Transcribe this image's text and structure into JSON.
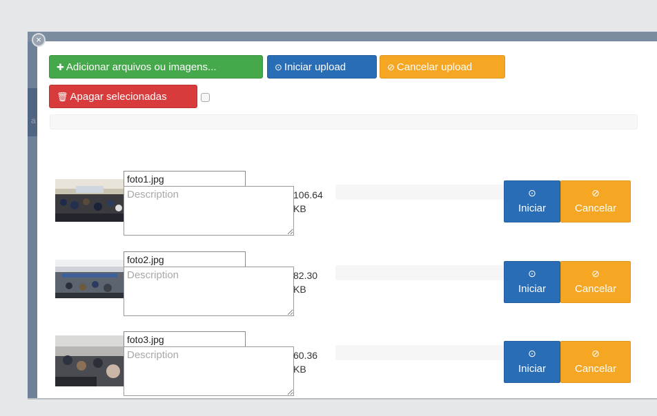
{
  "toolbar": {
    "add_label": "Adicionar arquivos ou imagens...",
    "add_icon": "plus-icon",
    "start_label": "Iniciar upload",
    "start_icon": "circle-arrow-up-icon",
    "cancel_label": "Cancelar upload",
    "cancel_icon": "ban-circle-icon",
    "delete_label": "Apagar selecionadas",
    "delete_icon": "trash-icon"
  },
  "backdrop": {
    "letter": "a"
  },
  "files": [
    {
      "name": "foto1.jpg",
      "description_placeholder": "Description",
      "size_value": "106.64",
      "size_unit": "KB",
      "start_label": "Iniciar",
      "cancel_label": "Cancelar"
    },
    {
      "name": "foto2.jpg",
      "description_placeholder": "Description",
      "size_value": "82.30",
      "size_unit": "KB",
      "start_label": "Iniciar",
      "cancel_label": "Cancelar"
    },
    {
      "name": "foto3.jpg",
      "description_placeholder": "Description",
      "size_value": "60.36",
      "size_unit": "KB",
      "start_label": "Iniciar",
      "cancel_label": "Cancelar"
    }
  ],
  "colors": {
    "green": "#45a84a",
    "blue": "#2a6db7",
    "orange": "#f5a623",
    "red": "#d83b3b",
    "page_bg": "#e6e7e9"
  }
}
